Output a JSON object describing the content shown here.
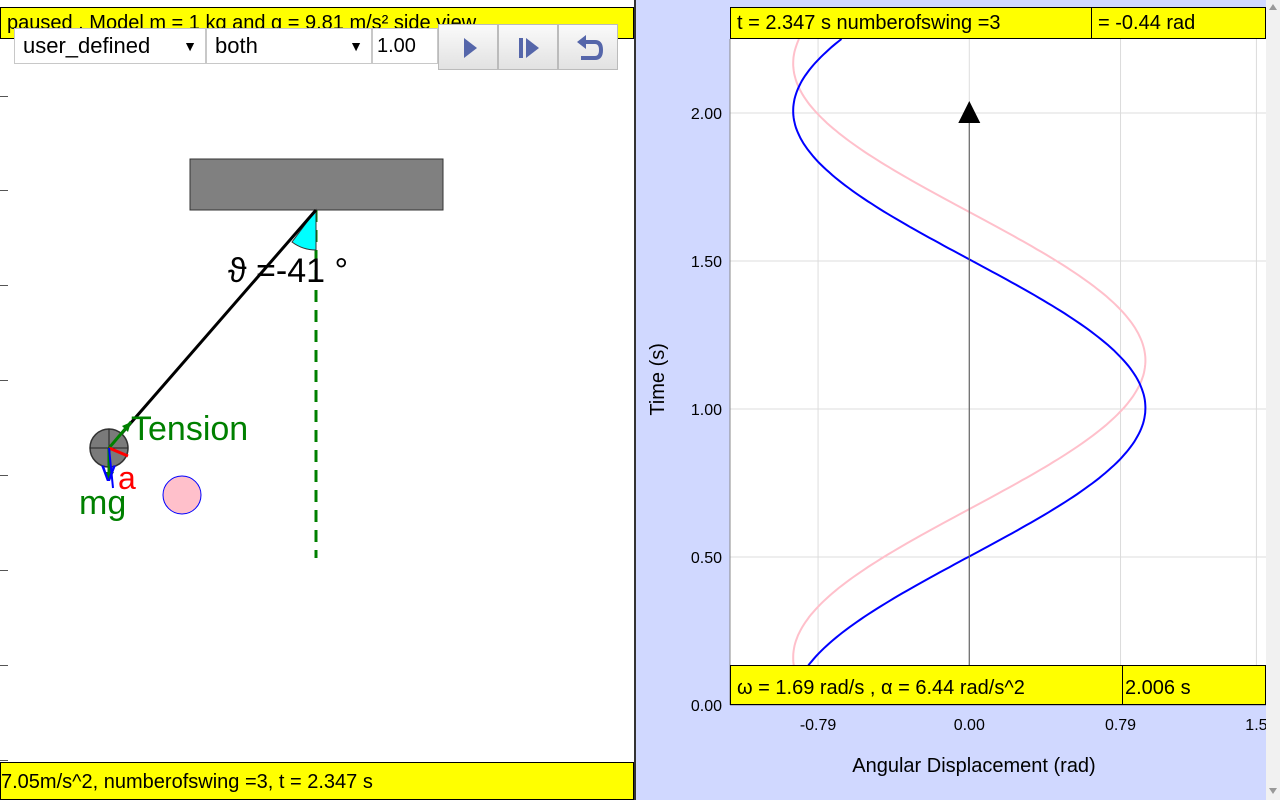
{
  "left": {
    "top_status": "paused , Model m = 1 kg and g = 9.81 m/s² side view",
    "controls": {
      "mode_select": "user_defined",
      "view_select": "both",
      "speed_value": "1.00"
    },
    "angle_label": "ϑ =-41 °",
    "force_labels": {
      "tension": "Tension",
      "accel": "a",
      "weight": "mg",
      "velocity": "v"
    },
    "bottom_status": "7.05m/s^2, numberofswing =3, t = 2.347 s",
    "colors": {
      "tension": "#008000",
      "accel": "#ff0000",
      "velocity": "#0000ff",
      "ghost": "#ffc0cb"
    }
  },
  "right": {
    "top_status_left": "t = 2.347 s numberofswing =3",
    "top_status_right": "= -0.44 rad",
    "bottom_status_left": "ω = 1.69 rad/s , α = 6.44 rad/s^2",
    "bottom_status_right": "2.006 s"
  },
  "chart_data": {
    "type": "line",
    "xlabel": "Angular Displacement (rad)",
    "ylabel": "Time (s)",
    "xlim": [
      -1.25,
      1.55
    ],
    "ylim": [
      0,
      2.25
    ],
    "x_ticks": [
      "-0.79",
      "0.00",
      "0.79",
      "1.5"
    ],
    "x_tick_values": [
      -0.79,
      0.0,
      0.79,
      1.5
    ],
    "y_ticks": [
      "0.00",
      "0.50",
      "1.00",
      "1.50",
      "2.00"
    ],
    "y_tick_values": [
      0.0,
      0.5,
      1.0,
      1.5,
      2.0
    ],
    "grid": true,
    "series": [
      {
        "color": "#0000ff",
        "amplitude": 0.92,
        "omega": 3.13,
        "phase": 0.0,
        "t_start": 0.13,
        "t_end": 2.25
      },
      {
        "color": "#ffc0cb",
        "amplitude": 0.92,
        "omega": 3.13,
        "phase": 0.16,
        "t_start": 0.12,
        "t_end": 2.25
      }
    ],
    "arrow_top": 2.0
  }
}
